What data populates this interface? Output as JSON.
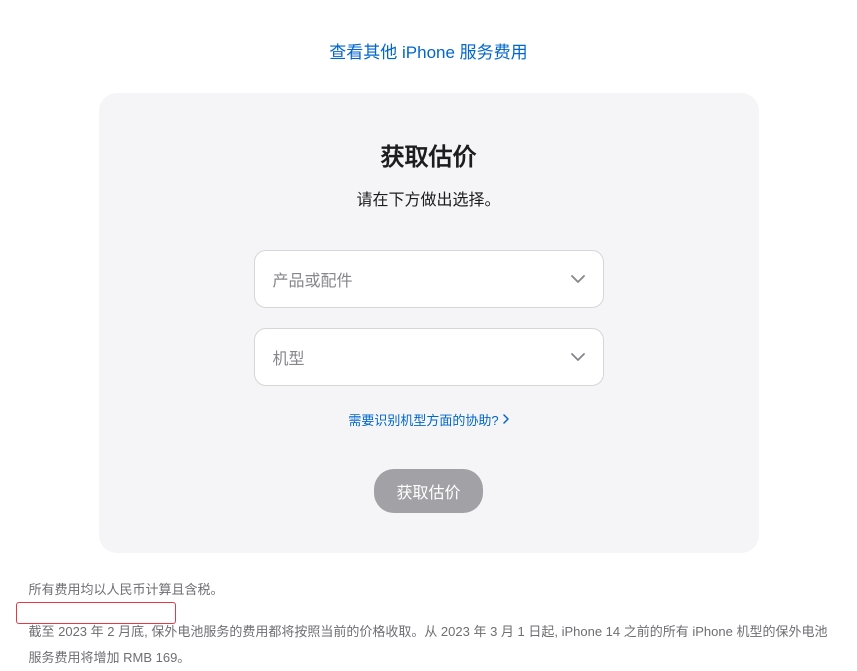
{
  "topLink": {
    "label": "查看其他 iPhone 服务费用"
  },
  "card": {
    "title": "获取估价",
    "subtitle": "请在下方做出选择。",
    "select1": {
      "placeholder": "产品或配件"
    },
    "select2": {
      "placeholder": "机型"
    },
    "helpLink": {
      "label": "需要识别机型方面的协助?"
    },
    "button": {
      "label": "获取估价"
    }
  },
  "footnotes": {
    "line1": "所有费用均以人民币计算且含税。",
    "line2": "截至 2023 年 2 月底, 保外电池服务的费用都将按照当前的价格收取。从 2023 年 3 月 1 日起, iPhone 14 之前的所有 iPhone 机型的保外电池服务费用将增加 RMB 169。"
  }
}
